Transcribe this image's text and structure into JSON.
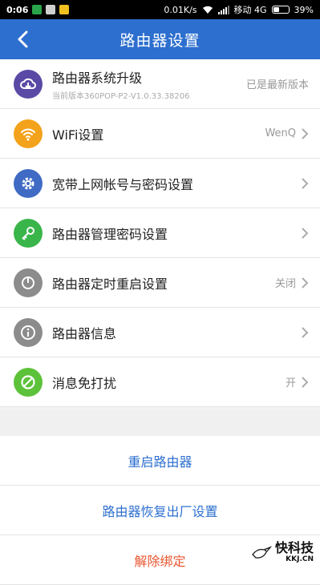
{
  "status_bar": {
    "time": "0:06",
    "network_speed": "0.01K/s",
    "carrier": "移动 4G",
    "battery": "39%",
    "battery_level": 0.39
  },
  "header": {
    "title": "路由器设置",
    "back_icon": "back-arrow-icon"
  },
  "settings": [
    {
      "label": "路由器系统升级",
      "sub": "当前版本360POP-P2-V1.0.33.38206",
      "value": "已是最新版本",
      "icon": "cloud-download-icon",
      "color": "#5a4aa5",
      "chevron": false
    },
    {
      "label": "WiFi设置",
      "value": "WenQ",
      "icon": "wifi-icon",
      "color": "#f3a21b",
      "chevron": true
    },
    {
      "label": "宽带上网帐号与密码设置",
      "value": "",
      "icon": "gear-icon",
      "color": "#3f6bc4",
      "chevron": true
    },
    {
      "label": "路由器管理密码设置",
      "value": "",
      "icon": "key-icon",
      "color": "#3ab54a",
      "chevron": true
    },
    {
      "label": "路由器定时重启设置",
      "value": "关闭",
      "icon": "timer-icon",
      "color": "#8c8c8c",
      "chevron": true
    },
    {
      "label": "路由器信息",
      "value": "",
      "icon": "info-icon",
      "color": "#8c8c8c",
      "chevron": true
    },
    {
      "label": "消息免打扰",
      "value": "开",
      "icon": "do-not-disturb-icon",
      "color": "#5cc23a",
      "chevron": true
    }
  ],
  "actions": {
    "restart": "重启路由器",
    "factory_reset": "路由器恢复出厂设置",
    "unbind": "解除绑定"
  },
  "watermark": {
    "name": "快科技",
    "domain": "KKJ.CN"
  }
}
